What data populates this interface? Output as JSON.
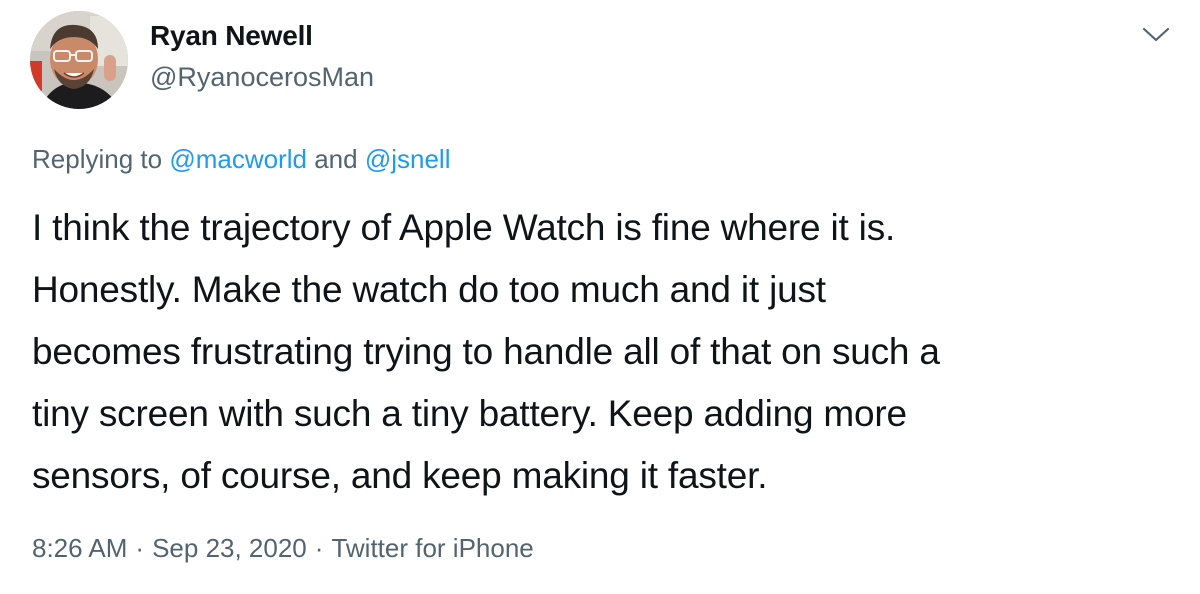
{
  "author": {
    "name": "Ryan Newell",
    "handle": "@RyanocerosMan"
  },
  "menu": {
    "icon": "chevron-down-icon"
  },
  "reply": {
    "prefix": "Replying to",
    "mention_1": "@macworld",
    "conjunction": "and",
    "mention_2": "@jsnell"
  },
  "body_lines": [
    "I think the trajectory of Apple Watch is fine where it is.",
    "Honestly. Make the watch do too much and it just",
    "becomes frustrating trying to handle all of that on such a",
    "tiny screen with such a tiny battery. Keep adding more",
    "sensors, of course, and keep making it faster."
  ],
  "meta": {
    "time": "8:26 AM",
    "date": "Sep 23, 2020",
    "separator": "·",
    "source": "Twitter for iPhone"
  },
  "colors": {
    "text": "#0f1419",
    "secondary": "#536471",
    "link": "#1d9bf0"
  }
}
